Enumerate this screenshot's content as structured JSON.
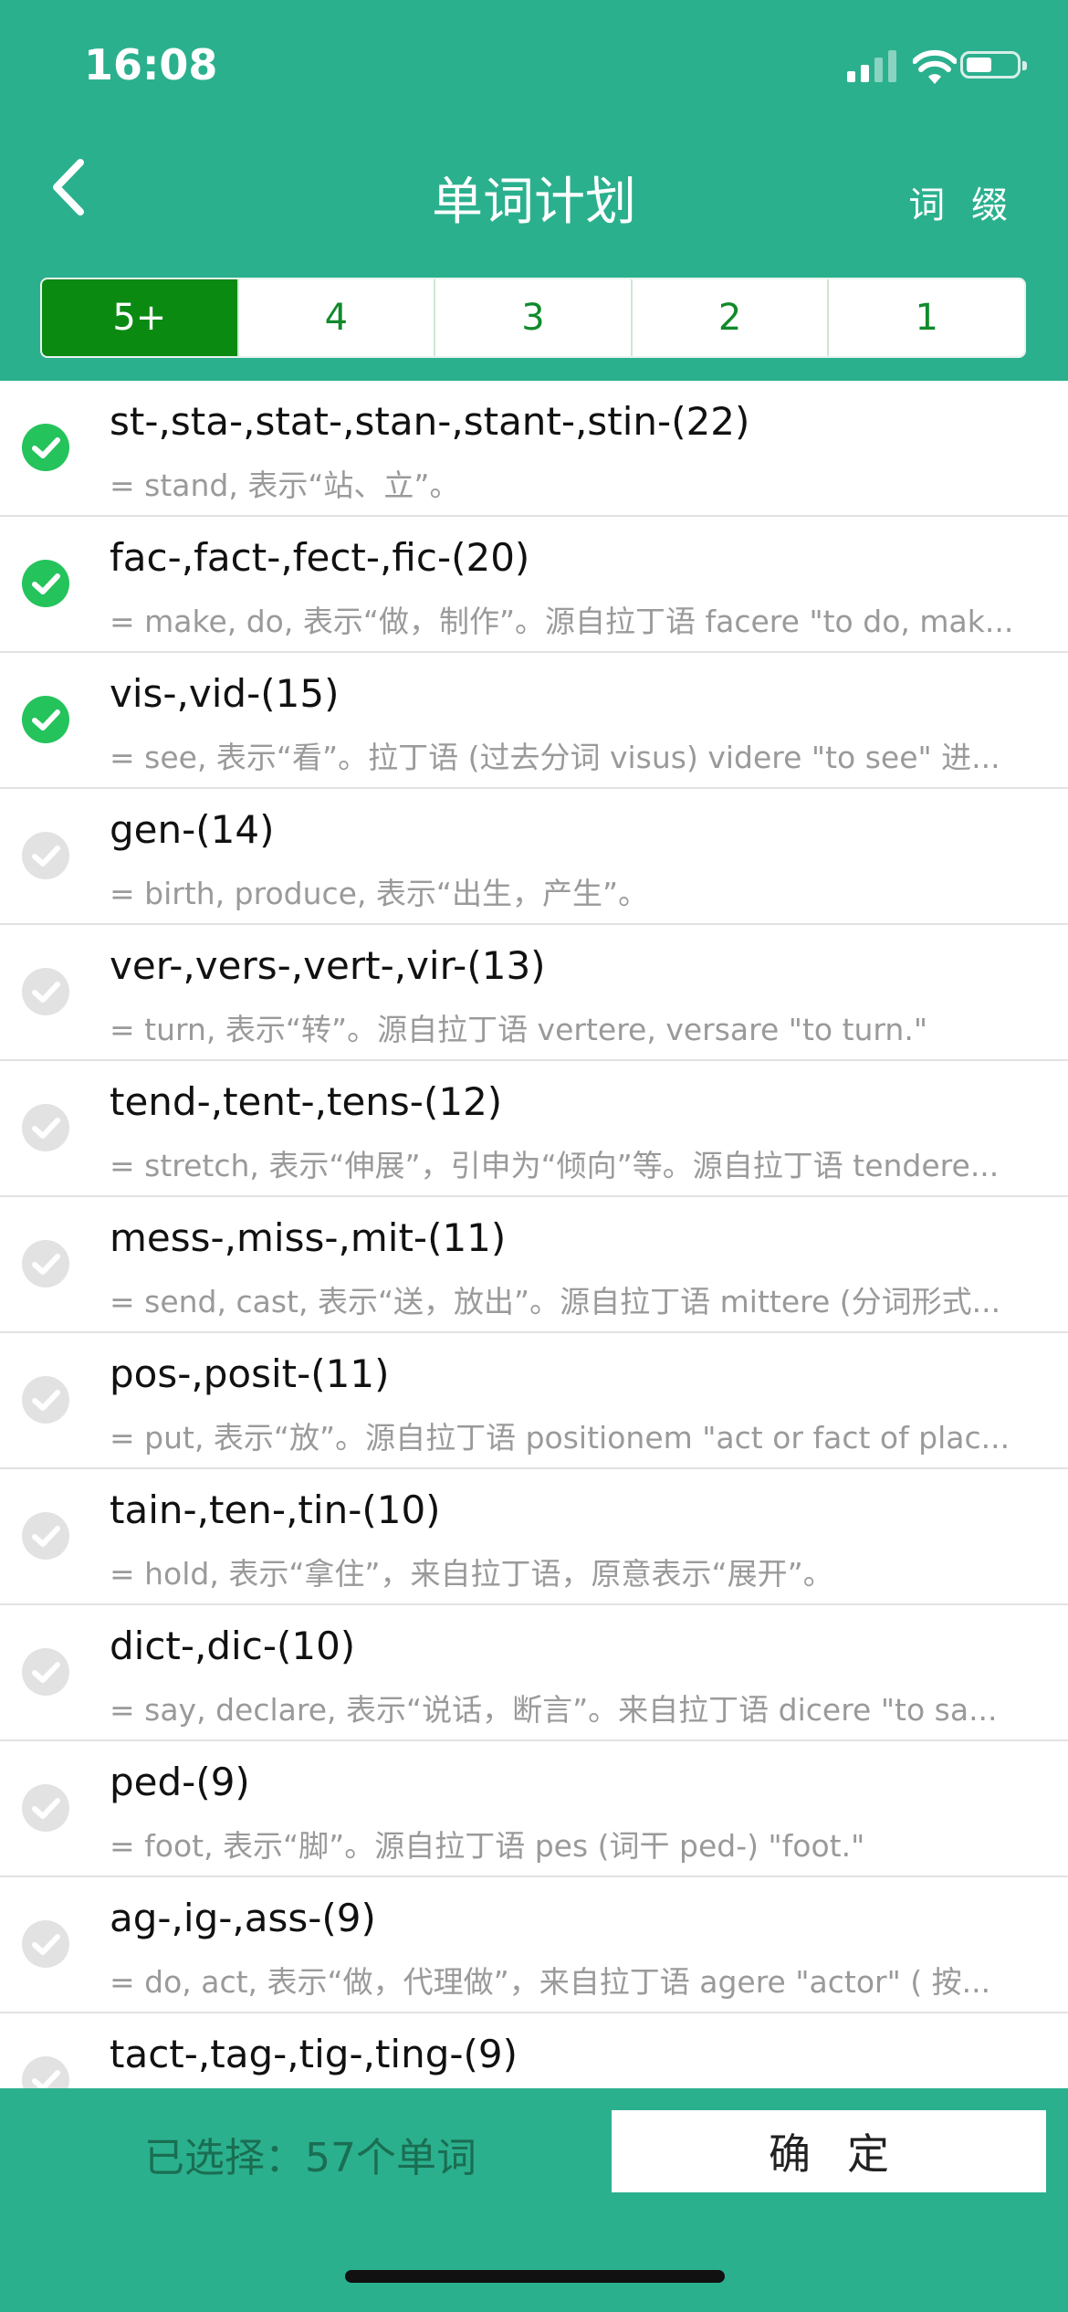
{
  "status": {
    "time": "16:08",
    "battery": 0.5
  },
  "header": {
    "title": "单词计划",
    "affix_label": "词 缀"
  },
  "tabs": [
    {
      "label": "5+",
      "active": true
    },
    {
      "label": "4",
      "active": false
    },
    {
      "label": "3",
      "active": false
    },
    {
      "label": "2",
      "active": false
    },
    {
      "label": "1",
      "active": false
    }
  ],
  "rows": [
    {
      "title": "st-,sta-,stat-,stan-,stant-,stin-(22)",
      "desc": "= stand, 表示“站、立”。",
      "checked": true
    },
    {
      "title": "fac-,fact-,fect-,fic-(20)",
      "desc": "= make, do, 表示“做，制作”。源自拉丁语 facere \"to do, mak...",
      "checked": true
    },
    {
      "title": "vis-,vid-(15)",
      "desc": "= see, 表示“看”。拉丁语 (过去分词 visus) videre \"to see\" 进...",
      "checked": true
    },
    {
      "title": "gen-(14)",
      "desc": "= birth, produce, 表示“出生，产生”。",
      "checked": false
    },
    {
      "title": "ver-,vers-,vert-,vir-(13)",
      "desc": "= turn, 表示“转”。源自拉丁语 vertere, versare \"to turn.\"",
      "checked": false
    },
    {
      "title": "tend-,tent-,tens-(12)",
      "desc": "= stretch, 表示“伸展”，引申为“倾向”等。源自拉丁语 tendere...",
      "checked": false
    },
    {
      "title": "mess-,miss-,mit-(11)",
      "desc": "= send, cast, 表示“送，放出”。源自拉丁语 mittere (分词形式...",
      "checked": false
    },
    {
      "title": "pos-,posit-(11)",
      "desc": "= put, 表示“放”。源自拉丁语 positionem \"act or fact of plac...",
      "checked": false
    },
    {
      "title": "tain-,ten-,tin-(10)",
      "desc": "= hold, 表示“拿住”，来自拉丁语，原意表示“展开”。",
      "checked": false
    },
    {
      "title": "dict-,dic-(10)",
      "desc": "= say, declare, 表示“说话，断言”。来自拉丁语 dicere \"to sa...",
      "checked": false
    },
    {
      "title": "ped-(9)",
      "desc": "= foot, 表示“脚”。源自拉丁语 pes (词干 ped-) \"foot.\"",
      "checked": false
    },
    {
      "title": "ag-,ig-,ass-(9)",
      "desc": "= do, act, 表示“做，代理做”，来自拉丁语 agere \"actor\" ( 按...",
      "checked": false
    },
    {
      "title": "tact-,tag-,tig-,ting-(9)",
      "desc": "",
      "checked": false
    }
  ],
  "footer": {
    "selected_text": "已选择：57个单词",
    "confirm_label": "确定"
  },
  "colors": {
    "primary": "#2bb08e",
    "active_tab": "#0b8a12",
    "check_on": "#25c35b",
    "check_off": "#e2e2e2"
  }
}
